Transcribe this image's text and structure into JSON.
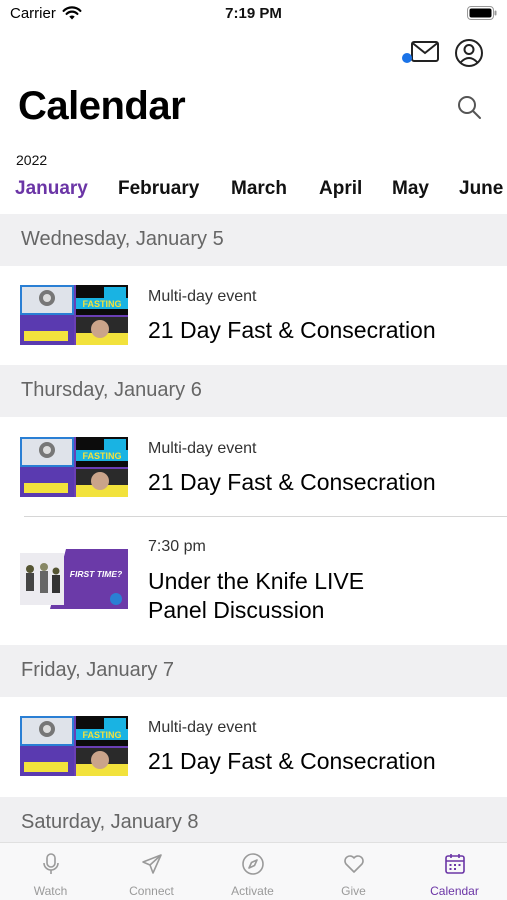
{
  "status_bar": {
    "carrier": "Carrier",
    "time": "7:19 PM"
  },
  "header": {
    "title": "Calendar",
    "year": "2022"
  },
  "months": [
    "January",
    "February",
    "March",
    "April",
    "May",
    "June"
  ],
  "active_month": "January",
  "days": [
    {
      "label": "Wednesday, January 5",
      "events": [
        {
          "kind": "Multi-day event",
          "title": "21 Day Fast & Consecration",
          "thumb": "fasting",
          "thumb_text": "FASTING"
        }
      ]
    },
    {
      "label": "Thursday, January 6",
      "events": [
        {
          "kind": "Multi-day event",
          "title": "21 Day Fast & Consecration",
          "thumb": "fasting",
          "thumb_text": "FASTING"
        },
        {
          "kind": "7:30 pm",
          "title_line1": "Under the Knife LIVE",
          "title_line2": "Panel Discussion",
          "thumb": "first-time",
          "thumb_text": "FIRST TIME?"
        }
      ]
    },
    {
      "label": "Friday, January 7",
      "events": [
        {
          "kind": "Multi-day event",
          "title": "21 Day Fast & Consecration",
          "thumb": "fasting",
          "thumb_text": "FASTING"
        }
      ]
    },
    {
      "label": "Saturday, January 8",
      "events": []
    }
  ],
  "tabs": [
    {
      "label": "Watch",
      "icon": "microphone-icon"
    },
    {
      "label": "Connect",
      "icon": "paper-plane-icon"
    },
    {
      "label": "Activate",
      "icon": "compass-icon"
    },
    {
      "label": "Give",
      "icon": "heart-icon"
    },
    {
      "label": "Calendar",
      "icon": "calendar-icon",
      "active": true
    }
  ],
  "colors": {
    "accent": "#6b35a6",
    "notification_dot": "#1a73e8",
    "section_bg": "#f0f0f2"
  }
}
